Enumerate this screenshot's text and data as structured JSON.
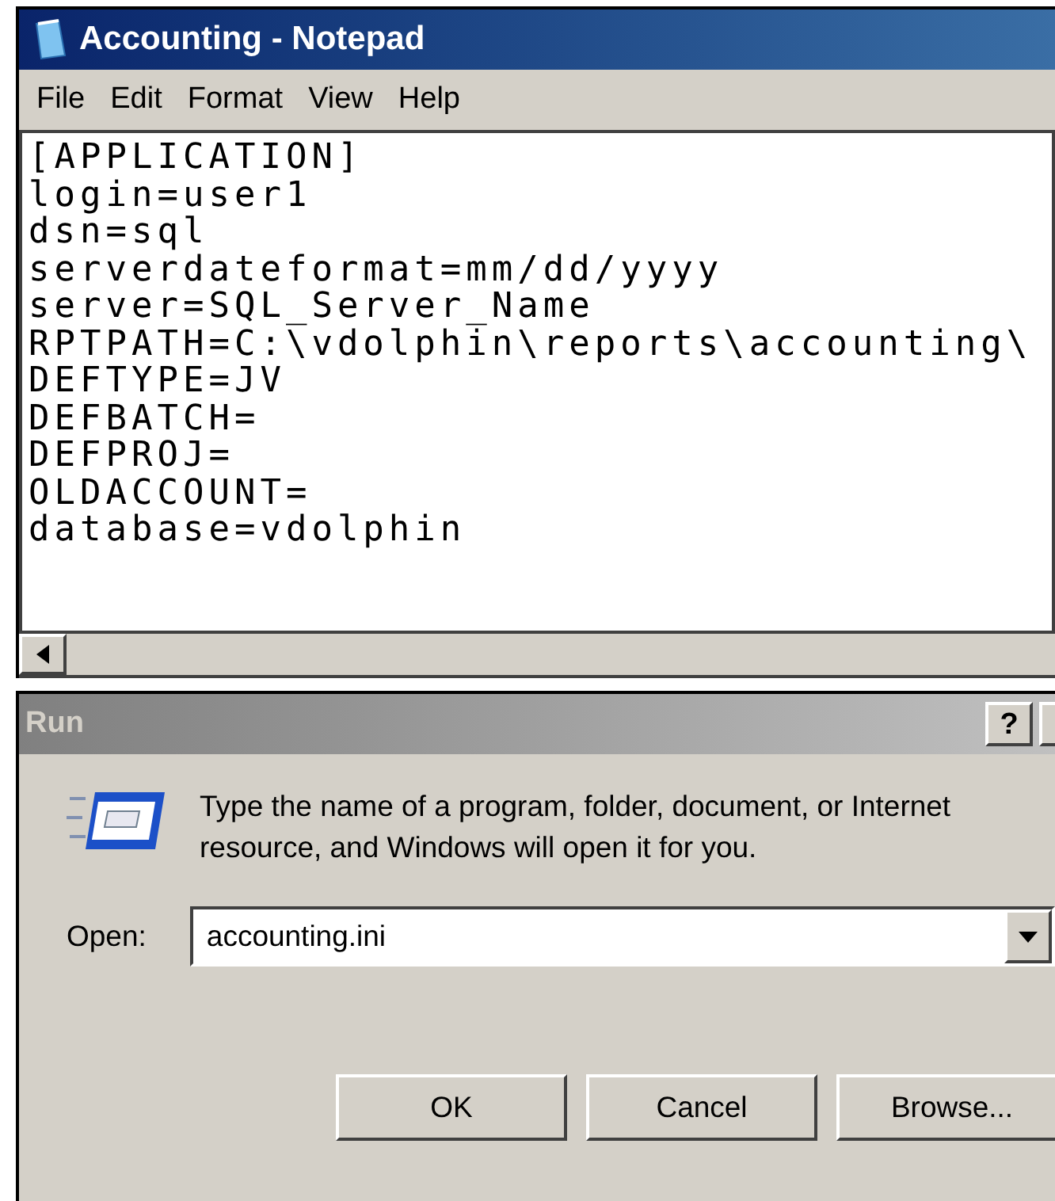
{
  "notepad": {
    "title": "Accounting - Notepad",
    "menu": [
      "File",
      "Edit",
      "Format",
      "View",
      "Help"
    ],
    "lines": [
      "[APPLICATION]",
      "login=user1",
      "dsn=sql",
      "serverdateformat=mm/dd/yyyy",
      "server=SQL_Server_Name",
      "RPTPATH=C:\\vdolphin\\reports\\accounting\\",
      "DEFTYPE=JV",
      "DEFBATCH=",
      "DEFPROJ=",
      "OLDACCOUNT=",
      "database=vdolphin"
    ]
  },
  "run": {
    "title": "Run",
    "help": "?",
    "description": "Type the name of a program, folder, document, or Internet resource, and Windows will open it for you.",
    "open_label": "Open:",
    "open_value": "accounting.ini",
    "buttons": [
      "OK",
      "Cancel",
      "Browse..."
    ]
  }
}
